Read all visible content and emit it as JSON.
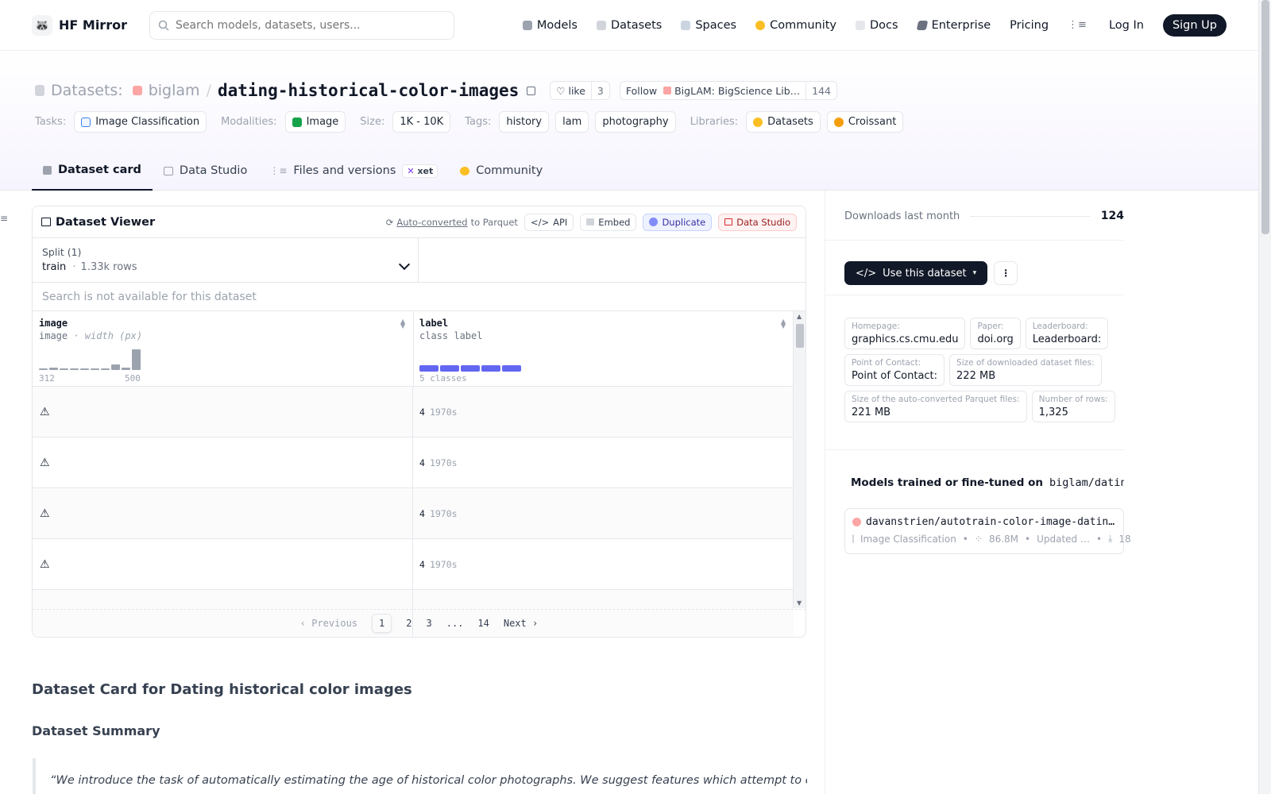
{
  "header": {
    "brand": "HF Mirror",
    "search_placeholder": "Search models, datasets, users...",
    "nav": [
      {
        "label": "Models",
        "color": "#9ca3af"
      },
      {
        "label": "Datasets",
        "color": "#d1d5db"
      },
      {
        "label": "Spaces",
        "color": "#cbd5e1"
      },
      {
        "label": "Community",
        "color": "#fbbf24"
      },
      {
        "label": "Docs",
        "color": "#e5e7eb"
      },
      {
        "label": "Enterprise",
        "color": "#6b7280"
      },
      {
        "label": "Pricing"
      }
    ],
    "login": "Log In",
    "signup": "Sign Up"
  },
  "repo": {
    "prefix": "Datasets:",
    "owner": "biglam",
    "sep": "/",
    "name": "dating-historical-color-images",
    "like_label": "like",
    "like_count": "3",
    "follow_label": "Follow",
    "org_name": "BigLAM: BigScience Lib…",
    "follow_count": "144"
  },
  "tags": {
    "tasks_label": "Tasks:",
    "task": "Image Classification",
    "modalities_label": "Modalities:",
    "modality": "Image",
    "size_label": "Size:",
    "size": "1K - 10K",
    "tags_label": "Tags:",
    "tag_list": [
      "history",
      "lam",
      "photography"
    ],
    "libraries_label": "Libraries:",
    "libraries": [
      "Datasets",
      "Croissant"
    ]
  },
  "tabs": [
    {
      "label": "Dataset card",
      "active": true
    },
    {
      "label": "Data Studio"
    },
    {
      "label": "Files and versions",
      "badge": "xet"
    },
    {
      "label": "Community"
    }
  ],
  "viewer": {
    "title": "Dataset Viewer",
    "auto_converted": "Auto-converted",
    "to_parquet": "to Parquet",
    "api": "API",
    "embed": "Embed",
    "duplicate": "Duplicate",
    "data_studio": "Data Studio",
    "split_label": "Split (1)",
    "split_value": "train",
    "split_dot": "·",
    "split_rows": "1.33k rows",
    "search_na": "Search is not available for this dataset",
    "columns": [
      {
        "name": "image",
        "type": "image",
        "subtype": "· width (px)",
        "min": "312",
        "max": "500"
      },
      {
        "name": "label",
        "type": "class label",
        "classes": "5 classes"
      }
    ],
    "histogram": [
      0.08,
      0.12,
      0.06,
      0.06,
      0.06,
      0.06,
      0.06,
      0.25,
      0.12,
      1.0
    ],
    "class_distribution": [
      0.2,
      0.2,
      0.2,
      0.2,
      0.2
    ],
    "rows": [
      {
        "label_id": "4",
        "label_name": "1970s"
      },
      {
        "label_id": "4",
        "label_name": "1970s"
      },
      {
        "label_id": "4",
        "label_name": "1970s"
      },
      {
        "label_id": "4",
        "label_name": "1970s"
      }
    ],
    "pager": {
      "previous": "Previous",
      "pages": [
        "1",
        "2",
        "3",
        "...",
        "14"
      ],
      "next": "Next"
    }
  },
  "card": {
    "h1": "Dataset Card for Dating historical color images",
    "h2": "Dataset Summary",
    "quote": "“We introduce the task of automatically estimating the age of historical color photographs. We suggest features which attempt to capture"
  },
  "sidebar": {
    "downloads_label": "Downloads last month",
    "downloads": "124",
    "use_button": "Use this dataset",
    "meta": [
      {
        "k": "Homepage:",
        "v": "graphics.cs.cmu.edu"
      },
      {
        "k": "Paper:",
        "v": "doi.org"
      },
      {
        "k": "Leaderboard:",
        "v": "Leaderboard:"
      },
      {
        "k": "Point of Contact:",
        "v": "Point of Contact:"
      },
      {
        "k": "Size of downloaded dataset files:",
        "v": "222 MB"
      },
      {
        "k": "Size of the auto-converted Parquet files:",
        "v": "221 MB"
      },
      {
        "k": "Number of rows:",
        "v": "1,325"
      }
    ],
    "models_heading": "Models trained or fine-tuned on",
    "models_repo": "biglam/dating-...",
    "model": {
      "name": "davanstrien/autotrain-color-image-datin…",
      "task": "Image Classification",
      "params": "86.8M",
      "updated": "Updated …",
      "downloads": "18"
    }
  }
}
